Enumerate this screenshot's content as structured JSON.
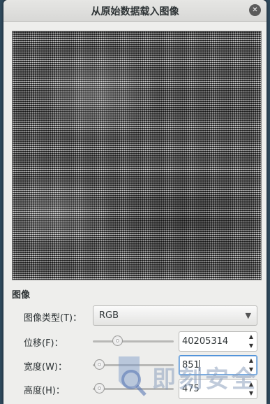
{
  "dialog": {
    "title": "从原始数据载入图像",
    "close_glyph": "✕"
  },
  "section": {
    "image_label": "图像"
  },
  "fields": {
    "image_type": {
      "label": "图像类型(T)：",
      "value": "RGB",
      "arrow": "▼"
    },
    "offset": {
      "label": "位移(F)：",
      "value": "40205314",
      "slider_fraction": 0.3
    },
    "width": {
      "label": "宽度(W)：",
      "value": "851",
      "slider_fraction": 0.08
    },
    "height": {
      "label": "高度(H)：",
      "value": "475",
      "slider_fraction": 0.08
    }
  },
  "spin_glyphs": {
    "up": "▲",
    "down": "▼"
  },
  "watermark": {
    "text": "即刻安全"
  }
}
